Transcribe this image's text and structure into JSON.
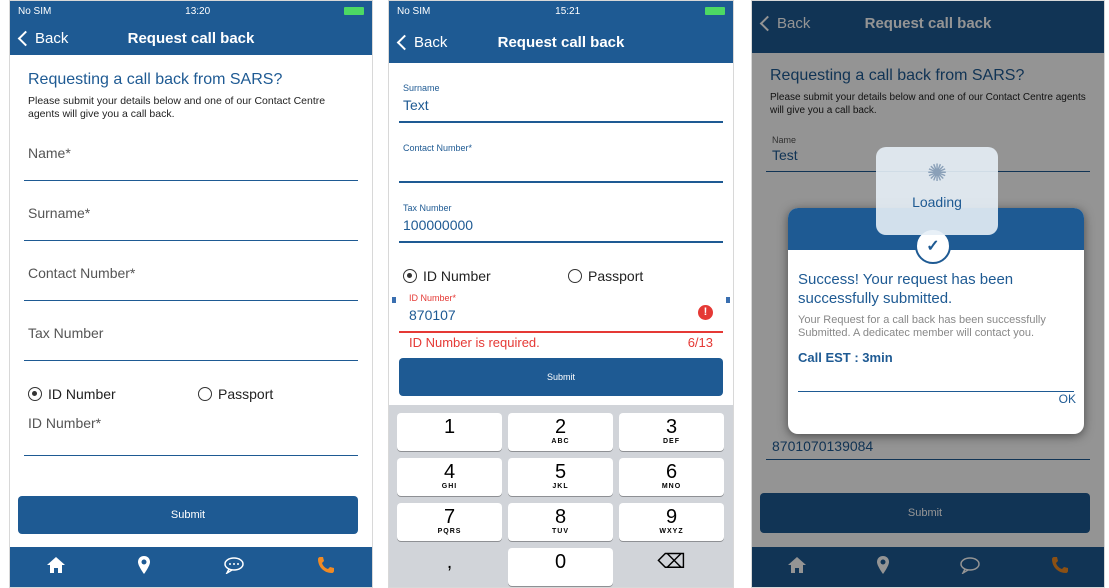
{
  "app": {
    "brand_color": "#1e5a93"
  },
  "screen1": {
    "status": {
      "carrier": "No SIM",
      "time": "13:20"
    },
    "nav": {
      "back_label": "Back",
      "title": "Request call back"
    },
    "heading": "Requesting a call back from SARS?",
    "intro": "Please submit your details below and one of our Contact Centre agents will give you a call back.",
    "fields": [
      "Name*",
      "Surname*",
      "Contact Number*",
      "Tax Number"
    ],
    "radio_id": "ID Number",
    "radio_passport": "Passport",
    "id_field": "ID Number*",
    "submit": "Submit",
    "tabs": [
      "home-icon",
      "location-pin-icon",
      "chat-icon",
      "phone-icon"
    ]
  },
  "screen2": {
    "status": {
      "carrier": "No SIM",
      "time": "15:21"
    },
    "nav": {
      "back_label": "Back",
      "title": "Request call back"
    },
    "surname_label": "Surname",
    "surname_value": "Text",
    "contact_label": "Contact Number*",
    "tax_label": "Tax Number",
    "tax_value": "100000000",
    "radio_id": "ID Number",
    "radio_passport": "Passport",
    "id_label": "ID Number*",
    "id_value": "870107",
    "error_text": "ID Number is required.",
    "counter": "6/13",
    "submit": "Submit",
    "keys": [
      {
        "d": "1",
        "l": ""
      },
      {
        "d": "2",
        "l": "ABC"
      },
      {
        "d": "3",
        "l": "DEF"
      },
      {
        "d": "4",
        "l": "GHI"
      },
      {
        "d": "5",
        "l": "JKL"
      },
      {
        "d": "6",
        "l": "MNO"
      },
      {
        "d": "7",
        "l": "PQRS"
      },
      {
        "d": "8",
        "l": "TUV"
      },
      {
        "d": "9",
        "l": "WXYZ"
      },
      {
        "d": ",",
        "l": ""
      },
      {
        "d": "0",
        "l": ""
      },
      {
        "d": "⌫",
        "l": ""
      }
    ]
  },
  "screen3": {
    "nav": {
      "back_label": "Back",
      "title": "Request call back"
    },
    "heading": "Requesting a call back from SARS?",
    "intro": "Please submit your details below and one of our Contact Centre agents will give you a call back.",
    "name_label": "Name",
    "name_value": "Test",
    "id_value": "8701070139084",
    "submit": "Submit",
    "loading_text": "Loading",
    "success_title": "Success! Your request has been successfully submitted.",
    "success_body": "Your Request for a call back has been successfully Submitted. A dedicatec member will contact you.",
    "call_est": "Call EST : 3min",
    "ok_label": "OK"
  }
}
